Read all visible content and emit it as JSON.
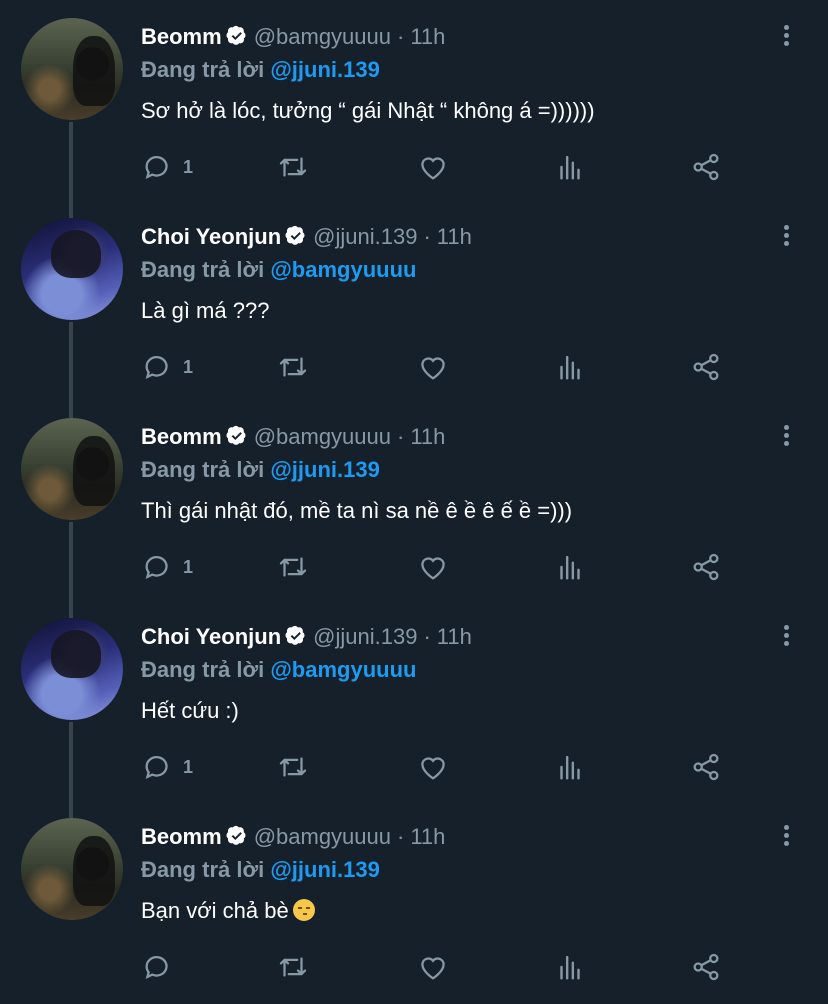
{
  "tweets": [
    {
      "name": "Beomm",
      "handle": "@bamgyuuuu",
      "time": "11h",
      "reply_prefix": "Đang trả lời",
      "reply_to": "@jjuni.139",
      "text": "Sơ hở là lóc, tưởng “ gái Nhật “ không á =))))))",
      "reply_count": "1",
      "avatar": "beomm"
    },
    {
      "name": "Choi Yeonjun",
      "handle": "@jjuni.139",
      "time": "11h",
      "reply_prefix": "Đang trả lời",
      "reply_to": "@bamgyuuuu",
      "text": "Là gì má ???",
      "reply_count": "1",
      "avatar": "yeonjun"
    },
    {
      "name": "Beomm",
      "handle": "@bamgyuuuu",
      "time": "11h",
      "reply_prefix": "Đang trả lời",
      "reply_to": "@jjuni.139",
      "text": "Thì gái nhật đó, mề ta nì sa nề ê ề ê ế ề =)))",
      "reply_count": "1",
      "avatar": "beomm"
    },
    {
      "name": "Choi Yeonjun",
      "handle": "@jjuni.139",
      "time": "11h",
      "reply_prefix": "Đang trả lời",
      "reply_to": "@bamgyuuuu",
      "text": "Hết cứu :)",
      "reply_count": "1",
      "avatar": "yeonjun"
    },
    {
      "name": "Beomm",
      "handle": "@bamgyuuuu",
      "time": "11h",
      "reply_prefix": "Đang trả lời",
      "reply_to": "@jjuni.139",
      "text": "Bạn với chả bè",
      "reply_count": "",
      "avatar": "beomm",
      "emoji": "unamused-face-emoji"
    }
  ],
  "icons": {
    "reply": "reply-icon",
    "retweet": "retweet-icon",
    "like": "heart-icon",
    "analytics": "analytics-icon",
    "share": "share-icon",
    "more": "more-vertical-icon",
    "verified": "verified-badge-icon"
  },
  "colors": {
    "background": "#15202b",
    "text": "#ffffff",
    "secondary": "#8899a6",
    "link": "#1d9bf0",
    "thread_line": "#38444d"
  }
}
